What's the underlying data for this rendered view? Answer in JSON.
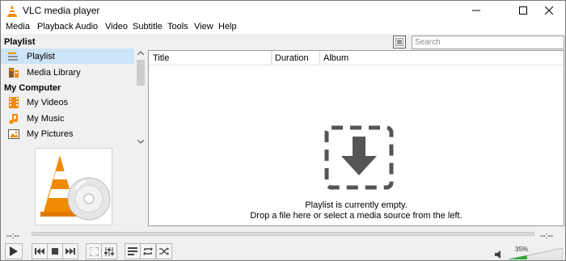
{
  "window": {
    "title": "VLC media player",
    "minimize_icon": "minimize-icon",
    "maximize_icon": "maximize-icon",
    "close_icon": "close-icon"
  },
  "menu": [
    "Media",
    "Playback",
    "Audio",
    "Video",
    "Subtitle",
    "Tools",
    "View",
    "Help"
  ],
  "sidebar": {
    "playlist_header": "Playlist",
    "computer_header": "My Computer",
    "items": [
      {
        "label": "Playlist",
        "icon": "playlist-icon",
        "selected": true
      },
      {
        "label": "Media Library",
        "icon": "media-library-icon",
        "selected": false
      },
      {
        "label": "My Videos",
        "icon": "film-icon",
        "selected": false
      },
      {
        "label": "My Music",
        "icon": "music-note-icon",
        "selected": false
      },
      {
        "label": "My Pictures",
        "icon": "picture-icon",
        "selected": false
      }
    ]
  },
  "search": {
    "placeholder": "Search",
    "value": ""
  },
  "playlist": {
    "columns": [
      "Title",
      "Duration",
      "Album"
    ],
    "empty_line1": "Playlist is currently empty.",
    "empty_line2": "Drop a file here or select a media source from the left."
  },
  "seek": {
    "elapsed": "--:--",
    "remaining": "--:--",
    "progress": 0
  },
  "volume": {
    "label": "35%",
    "level": 0.35
  },
  "colors": {
    "accent": "#cce4f7",
    "vlc_orange": "#f08a00",
    "icon_gray": "#555555"
  }
}
